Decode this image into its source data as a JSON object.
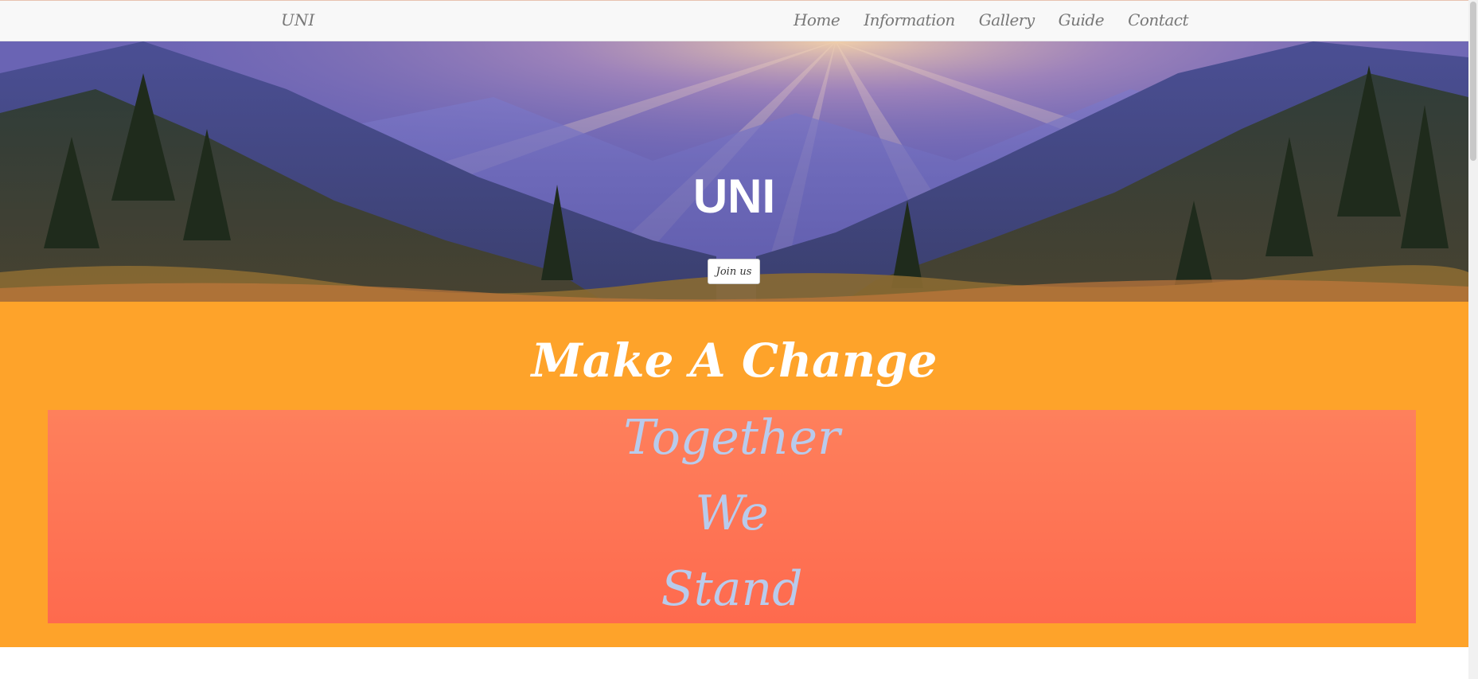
{
  "nav": {
    "brand": "UNI",
    "links": [
      "Home",
      "Information",
      "Gallery",
      "Guide",
      "Contact"
    ]
  },
  "hero": {
    "title": "UNI",
    "button_label": "Join us"
  },
  "change": {
    "heading": "Make A Change",
    "motto": [
      "Together",
      "We",
      "Stand"
    ]
  },
  "colors": {
    "navbar": "#f8f8f8",
    "orange_section": "#fea32a",
    "motto_box": "#fe7156",
    "motto_text": "#b8cbec",
    "hero_text": "#ffffff"
  }
}
